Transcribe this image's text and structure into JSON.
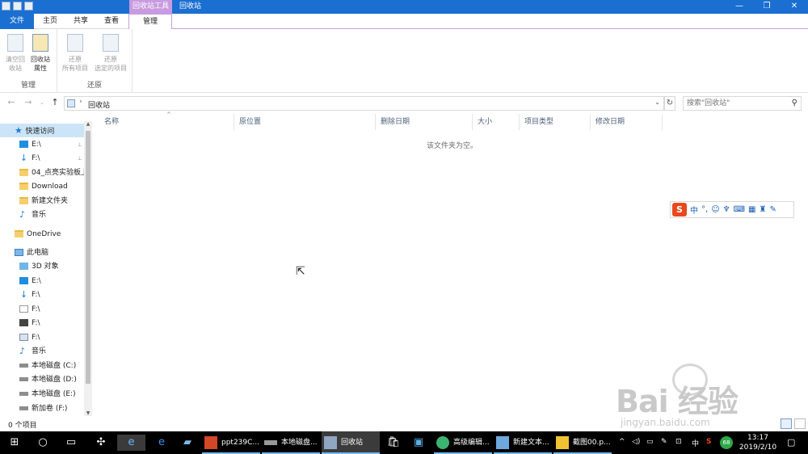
{
  "window": {
    "title": "回收站",
    "context_tool_label": "回收站工具",
    "controls": {
      "minimize": "—",
      "restore": "❐",
      "close": "✕"
    }
  },
  "tabs": {
    "file": "文件",
    "home": "主页",
    "share": "共享",
    "view": "查看",
    "manage": "管理"
  },
  "ribbon": {
    "collapse_icon": "⌄ ?",
    "manage_group": {
      "label": "管理",
      "empty_bin": "清空回\n收站",
      "properties": "回收站\n属性"
    },
    "restore_group": {
      "label": "还原",
      "restore_all": "还原\n所有项目",
      "restore_selected": "还原\n选定的项目"
    }
  },
  "address": {
    "path": "回收站",
    "separator": "›",
    "back": "←",
    "forward": "→",
    "history": "⌄",
    "up": "↑",
    "dropdown": "⌄",
    "refresh": "↻",
    "search_placeholder": "搜索\"回收站\"",
    "search_icon": "⚲"
  },
  "navpane": {
    "items": [
      {
        "label": "快速访问",
        "icon": "star-icon"
      },
      {
        "label": "E:\\",
        "icon": "drive-icon",
        "pin": "📌"
      },
      {
        "label": "F:\\",
        "icon": "download-icon",
        "pin": "📌"
      },
      {
        "label": "04_点亮实验板上",
        "icon": "folder-icon"
      },
      {
        "label": "Download",
        "icon": "folder-icon"
      },
      {
        "label": "新建文件夹",
        "icon": "folder-icon"
      },
      {
        "label": "音乐",
        "icon": "music-icon"
      },
      {
        "label": "OneDrive",
        "icon": "onedrive-icon"
      },
      {
        "label": "此电脑",
        "icon": "pc-icon"
      },
      {
        "label": "3D 对象",
        "icon": "3d-icon"
      },
      {
        "label": "E:\\",
        "icon": "drive-icon"
      },
      {
        "label": "F:\\",
        "icon": "download-icon"
      },
      {
        "label": "F:\\",
        "icon": "document-icon"
      },
      {
        "label": "F:\\",
        "icon": "video-icon"
      },
      {
        "label": "F:\\",
        "icon": "picture-icon"
      },
      {
        "label": "音乐",
        "icon": "music-icon"
      },
      {
        "label": "本地磁盘 (C:)",
        "icon": "disk-icon"
      },
      {
        "label": "本地磁盘 (D:)",
        "icon": "disk-icon"
      },
      {
        "label": "本地磁盘 (E:)",
        "icon": "disk-icon"
      },
      {
        "label": "新加卷 (F:)",
        "icon": "disk-icon"
      }
    ]
  },
  "columns": [
    "名称",
    "原位置",
    "删除日期",
    "大小",
    "项目类型",
    "修改日期"
  ],
  "sort_indicator": "^",
  "empty_message": "该文件夹为空。",
  "ime_bar": {
    "logo": "S",
    "mode": "中"
  },
  "status": {
    "count": "0 个项目"
  },
  "watermark": {
    "brand": "Bai  经验",
    "url": "jingyan.baidu.com"
  },
  "taskbar": {
    "apps": [
      {
        "label": "ppt239C...",
        "icon": "powerpoint-icon"
      },
      {
        "label": "本地磁盘...",
        "icon": "drive-icon"
      },
      {
        "label": "回收站",
        "icon": "recycle-bin-icon",
        "active": true
      },
      {
        "label": "高级编辑...",
        "icon": "editor-icon"
      },
      {
        "label": "新建文本...",
        "icon": "notepad-icon"
      },
      {
        "label": "截图00.p...",
        "icon": "image-icon"
      }
    ],
    "tray": {
      "ime": "中",
      "badge": "68",
      "chevron": "^"
    },
    "time": "13:17",
    "date": "2019/2/10"
  }
}
